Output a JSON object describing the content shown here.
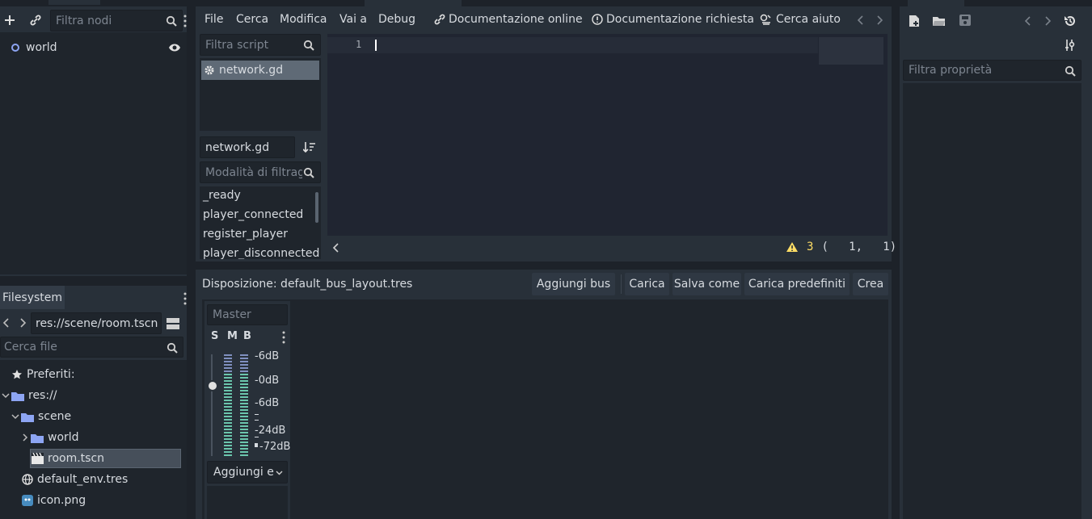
{
  "scene_dock": {
    "filter_placeholder": "Filtra nodi",
    "tree": [
      {
        "label": "world"
      }
    ]
  },
  "filesystem": {
    "tab_label": "Filesystem",
    "path": "res://scene/room.tscn",
    "search_placeholder": "Cerca file",
    "favorites_label": "Preferiti:",
    "items": [
      {
        "label": "res://"
      },
      {
        "label": "scene"
      },
      {
        "label": "world"
      },
      {
        "label": "room.tscn"
      },
      {
        "label": "default_env.tres"
      },
      {
        "label": "icon.png"
      }
    ]
  },
  "script_editor": {
    "menu": [
      "File",
      "Cerca",
      "Modifica",
      "Vai a",
      "Debug"
    ],
    "online_docs": "Documentazione online",
    "request_docs": "Documentazione richiesta",
    "search_help": "Cerca aiuto",
    "script_filter_placeholder": "Filtra script",
    "scripts": [
      {
        "label": "network.gd"
      }
    ],
    "current_script": "network.gd",
    "method_filter_placeholder": "Modalità di filtraggio",
    "methods": [
      "_ready",
      "player_connected",
      "register_player",
      "player_disconnected"
    ],
    "line_number": "1",
    "warning_count": "3",
    "cursor_position": "(   1,   1)"
  },
  "audio_panel": {
    "layout_label": "Disposizione: default_bus_layout.tres",
    "add_bus": "Aggiungi bus",
    "load": "Carica",
    "save_as": "Salva come",
    "load_default": "Carica predefiniti",
    "create": "Crea",
    "bus": {
      "name": "Master",
      "solo": "S",
      "mute": "M",
      "bypass": "B",
      "db_labels": [
        "-6dB",
        "-0dB",
        "-6dB",
        "-24dB",
        "-72dB"
      ],
      "add_effect": "Aggiungi e"
    }
  },
  "inspector": {
    "filter_placeholder": "Filtra proprietà"
  },
  "colors": {
    "accent": "#8da5f3",
    "warning": "#ffdd65",
    "selection": "#5f6a76",
    "meter": "#6bc6ad"
  }
}
